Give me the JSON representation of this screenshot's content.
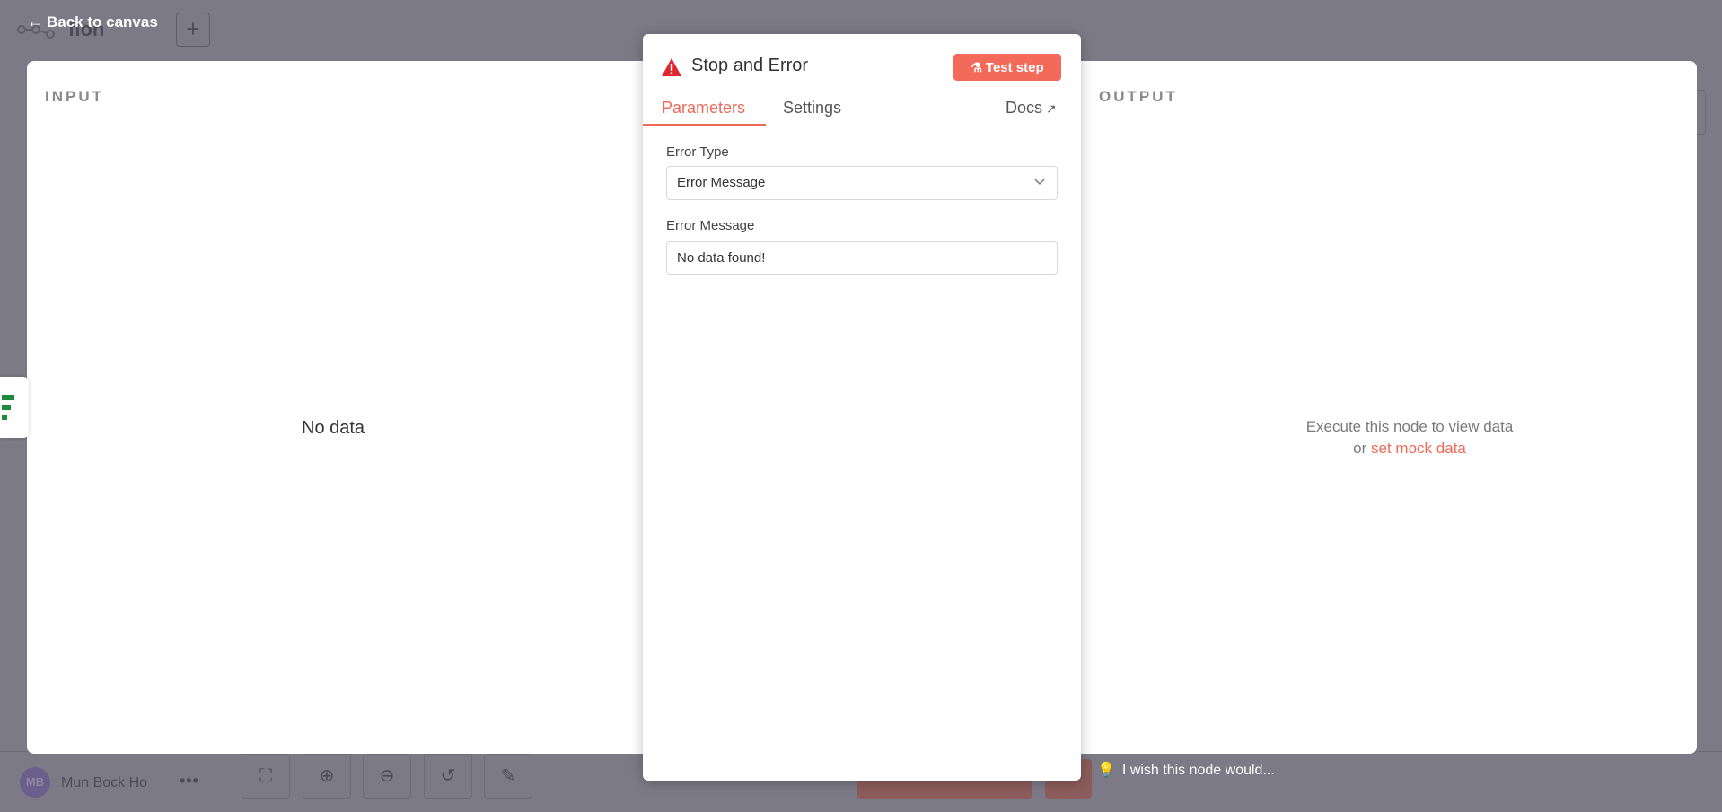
{
  "workflow": {
    "title": "flon",
    "add_label": "+"
  },
  "back_link": {
    "label": "Back to canvas"
  },
  "node": {
    "title": "Stop and Error",
    "test_button": "Test step",
    "tabs": {
      "parameters": "Parameters",
      "settings": "Settings",
      "docs": "Docs"
    },
    "fields": {
      "error_type": {
        "label": "Error Type",
        "value": "Error Message"
      },
      "error_message": {
        "label": "Error Message",
        "value": "No data found!"
      }
    }
  },
  "input_panel": {
    "label": "INPUT",
    "empty_text": "No data"
  },
  "output_panel": {
    "label": "OUTPUT",
    "line1": "Execute this node to view data",
    "or_text": "or",
    "mock_link": "set mock data"
  },
  "feedback": {
    "label": "I wish this node would..."
  },
  "footer": {
    "avatar_initials": "MB",
    "user_name": "Mun Bock Ho",
    "more": "•••"
  },
  "colors": {
    "accent": "#ee6a57",
    "test_button": "#f46a5a",
    "warning": "#e0262e",
    "overlay": "#7b7a86"
  },
  "icons": [
    "arrow-left-icon",
    "warning-icon",
    "flask-icon",
    "external-link-icon",
    "chevron-down-icon",
    "lightbulb-icon",
    "fit-view-icon",
    "zoom-in-icon",
    "zoom-out-icon",
    "undo-icon",
    "broom-icon"
  ]
}
